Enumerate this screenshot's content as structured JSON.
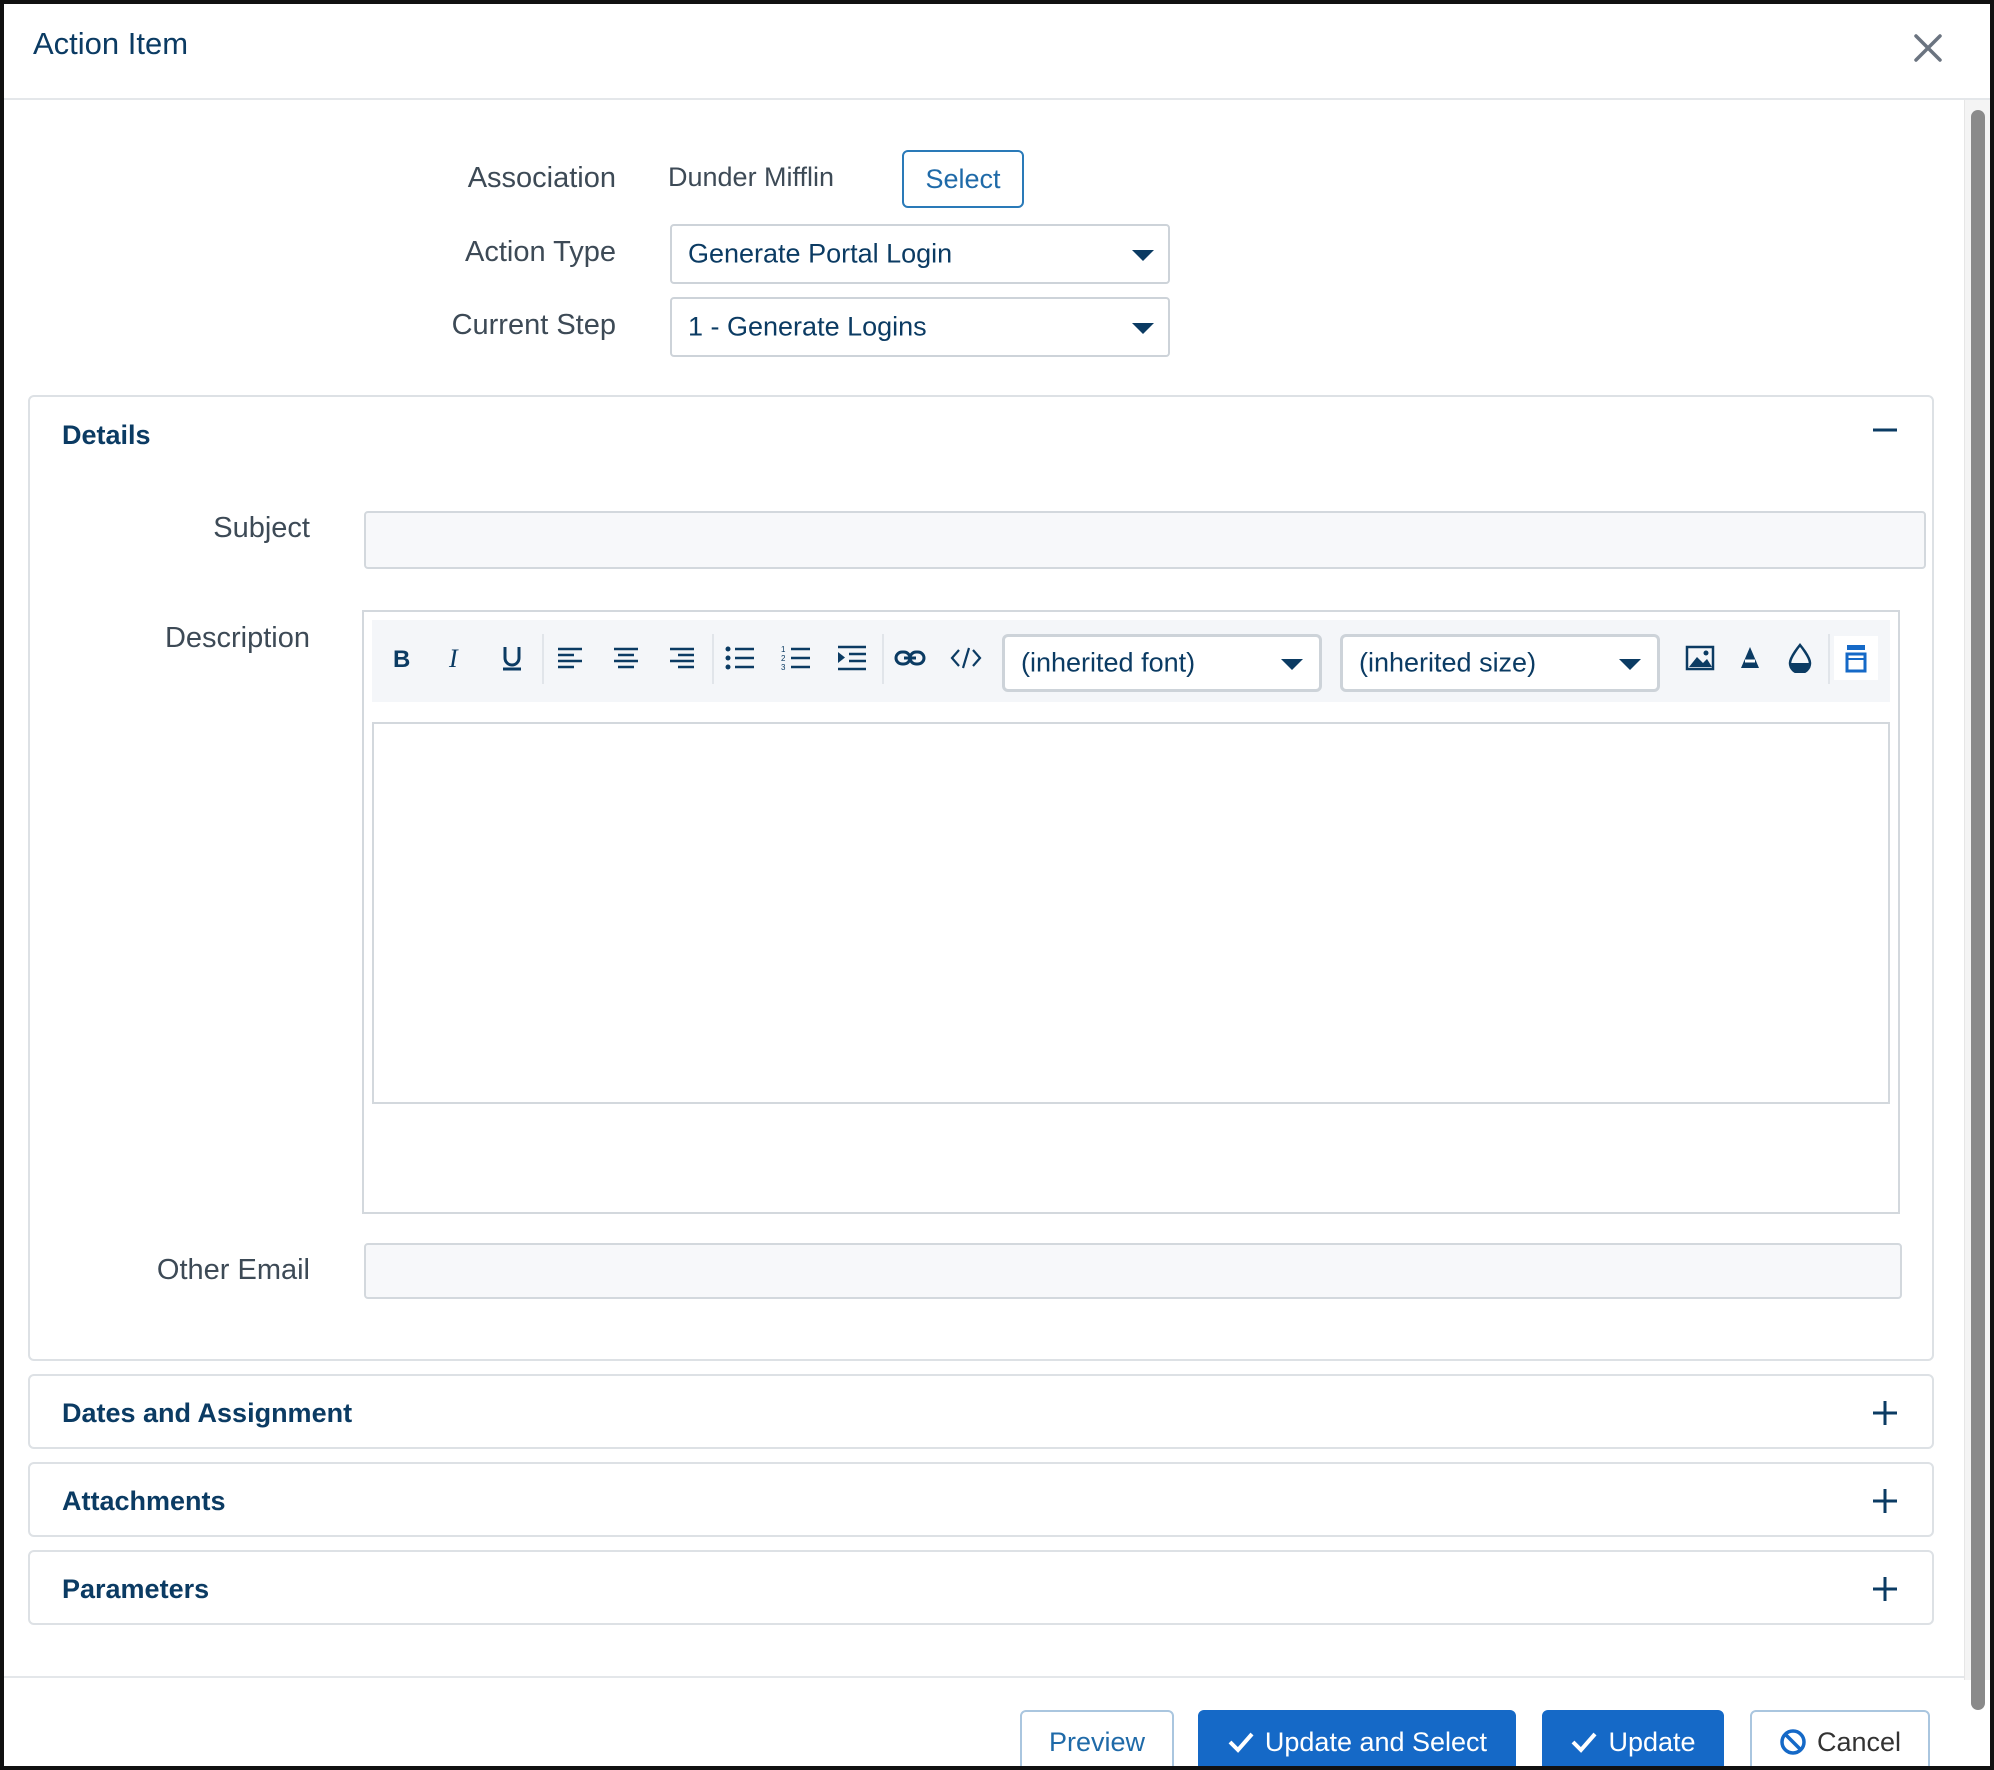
{
  "dialog": {
    "title": "Action Item"
  },
  "form": {
    "association": {
      "label": "Association",
      "value": "Dunder Mifflin",
      "select_button": "Select"
    },
    "action_type": {
      "label": "Action Type",
      "value": "Generate Portal Login"
    },
    "current_step": {
      "label": "Current Step",
      "value": "1 - Generate Logins"
    }
  },
  "details": {
    "title": "Details",
    "state": "expanded",
    "subject_label": "Subject",
    "subject_value": "",
    "description_label": "Description",
    "other_email_label": "Other Email",
    "other_email_value": "",
    "editor": {
      "font_select": "(inherited font)",
      "size_select": "(inherited size)",
      "toolbar_icons": [
        "bold-icon",
        "italic-icon",
        "underline-icon",
        "align-left-icon",
        "align-center-icon",
        "align-right-icon",
        "bullet-list-icon",
        "numbered-list-icon",
        "indent-icon",
        "link-icon",
        "code-icon",
        "image-icon",
        "font-color-icon",
        "background-color-icon",
        "view-html-icon"
      ]
    }
  },
  "sections": [
    {
      "title": "Dates and Assignment",
      "state": "collapsed"
    },
    {
      "title": "Attachments",
      "state": "collapsed"
    },
    {
      "title": "Parameters",
      "state": "collapsed"
    }
  ],
  "footer": {
    "preview": "Preview",
    "update_and_select": "Update and Select",
    "update": "Update",
    "cancel": "Cancel"
  },
  "colors": {
    "primary": "#1569c7",
    "heading": "#0b3b63"
  }
}
